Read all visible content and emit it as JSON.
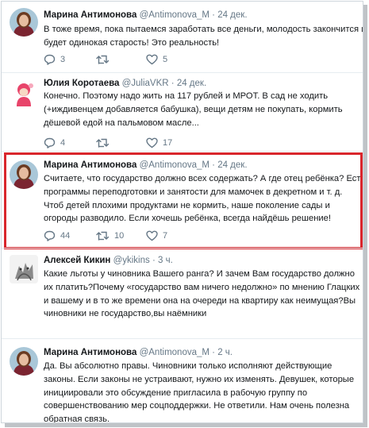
{
  "tweets": [
    {
      "name": "Марина Антимонова",
      "handle": "@Antimonova_M",
      "date": "· 24 дек.",
      "lines": [
        "В тоже время, пока пытаемся заработать все деньги, молодость закончится и",
        "будет одинокая старость! Это реальность!"
      ],
      "replies": "3",
      "retweets": "",
      "likes": "5"
    },
    {
      "name": "Юлия Коротаева",
      "handle": "@JuliaVKR",
      "date": "· 24 дек.",
      "lines": [
        "Конечно. Поэтому надо жить на 117 рублей и МРОТ. В сад не ходить",
        "(+иждивенцем добавляется бабушка), вещи детям не покупать, кормить",
        "дёшевой едой на пальмовом масле..."
      ],
      "replies": "4",
      "retweets": "",
      "likes": "17"
    },
    {
      "name": "Марина Антимонова",
      "handle": "@Antimonova_M",
      "date": "· 24 дек.",
      "lines": [
        "Считаете, что государство должно всех содержать?   А где отец ребёнка? Есть",
        "программы переподготовки и занятости для мамочек в декретном и т. д.",
        "Чтоб детей плохими продуктами не кормить, наше поколение сады и",
        "огороды разводило. Если хочешь ребёнка, всегда найдёшь решение!"
      ],
      "replies": "44",
      "retweets": "10",
      "likes": "7"
    },
    {
      "name": "Алексей Кикин",
      "handle": "@ykikins",
      "date": "· 3 ч.",
      "lines": [
        "Какие льготы у чиновника Вашего ранга? И зачем Вам государство должно",
        "их платить?Почему «государство вам ничего недолжно» по мнению Глацких",
        "и вашему и в то же времени она на очереди на квартиру как неимущая?Вы",
        "чиновники не государство,вы наёмники"
      ],
      "replies": "",
      "retweets": "",
      "likes": ""
    },
    {
      "name": "Марина Антимонова",
      "handle": "@Antimonova_M",
      "date": "· 2 ч.",
      "lines": [
        "Да. Вы абсолютно правы. Чиновники только исполняют действующие",
        "законы. Если законы не устраивают, нужно их изменять. Девушек, которые",
        "инициировали это обсуждение пригласила в рабочую группу по",
        "совершенствованию мер соцподдержки. Не ответили. Нам очень полезна",
        "обратная связь."
      ],
      "replies": "",
      "retweets": "",
      "likes": ""
    }
  ],
  "colors": {
    "highlight": "#d9262c",
    "muted": "#657786",
    "text": "#14171a"
  },
  "icons": [
    "reply-icon",
    "retweet-icon",
    "like-icon"
  ]
}
